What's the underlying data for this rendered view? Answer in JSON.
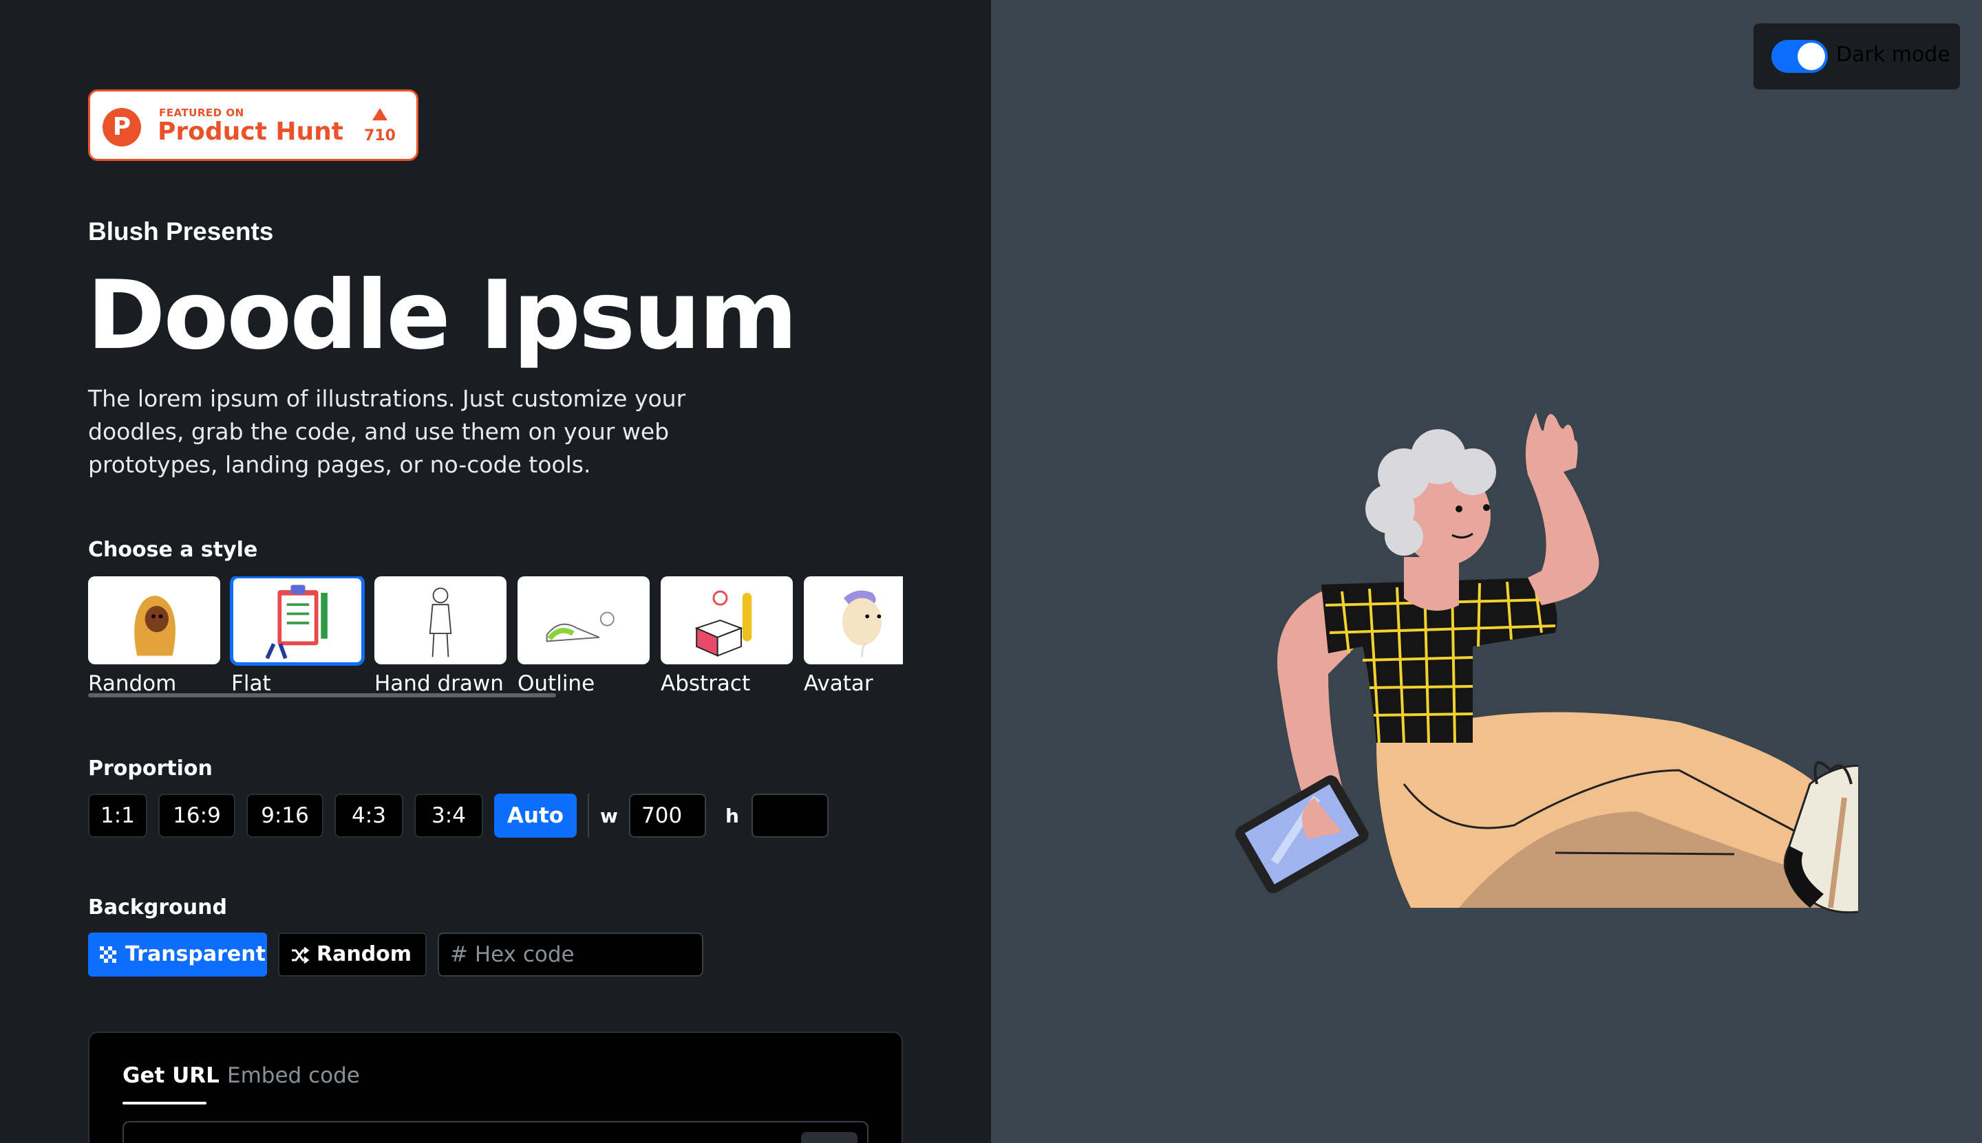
{
  "product_hunt": {
    "featured_on": "FEATURED ON",
    "name": "Product Hunt",
    "logo_letter": "P",
    "upvotes": "710"
  },
  "header": {
    "eyebrow": "Blush Presents",
    "title": "Doodle Ipsum",
    "description": "The lorem ipsum of illustrations. Just customize your doodles, grab the code, and use them on your web prototypes, landing pages, or no-code tools."
  },
  "style_section": {
    "label": "Choose a style",
    "selected": "Flat",
    "styles": [
      {
        "label": "Random"
      },
      {
        "label": "Flat"
      },
      {
        "label": "Hand drawn"
      },
      {
        "label": "Outline"
      },
      {
        "label": "Abstract"
      },
      {
        "label": "Avatar"
      }
    ]
  },
  "proportion_section": {
    "label": "Proportion",
    "options": [
      "1:1",
      "16:9",
      "9:16",
      "4:3",
      "3:4",
      "Auto"
    ],
    "selected": "Auto",
    "width_label": "w",
    "width_value": "700",
    "height_label": "h",
    "height_value": ""
  },
  "background_section": {
    "label": "Background",
    "transparent_label": "Transparent",
    "random_label": "Random",
    "hex_placeholder": "# Hex code",
    "selected": "Transparent"
  },
  "output_section": {
    "tabs": [
      "Get URL",
      "Embed code"
    ],
    "active_tab": "Get URL"
  },
  "theme_toggle": {
    "label": "Dark mode",
    "on": true
  },
  "colors": {
    "accent": "#0d6efd",
    "left_bg": "#1a1d21",
    "right_bg": "#3a444c",
    "product_hunt": "#ea532a"
  },
  "icons": {
    "transparent": "checkerboard-icon",
    "random": "shuffle-icon",
    "upvote": "triangle-up-icon"
  }
}
